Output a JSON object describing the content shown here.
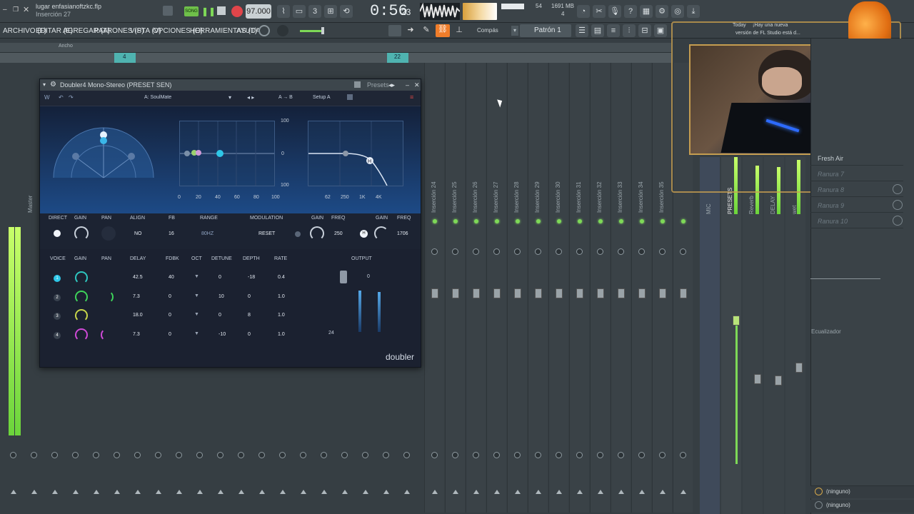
{
  "topbar": {
    "file_name": "lugar enfasianoftzkc.flp",
    "insert_label": "Inserción 27",
    "tempo": "97.000",
    "time": "0:56",
    "time_sub": "23",
    "cpu": "54",
    "memory": "1691 MB",
    "mem_sub": "4",
    "song_btn": "SONG",
    "notification_today": "Today",
    "notification_text": "¡Hay una nueva",
    "notification_text2": "versión de FL Studio está d..."
  },
  "menu": {
    "archivo": "ARCHIVO (F)",
    "editar": "EDITAR (E)",
    "agregar": "AGREGAR (A)",
    "patrones": "PATRONES (P)",
    "vista": "VISTA (V)",
    "opciones": "OPCIONES (O)",
    "herramientas": "HERRAMIENTAS (T)",
    "ayuda": "AYUDA",
    "snap_label": "Compás",
    "pattern": "Patrón 1"
  },
  "mixer": {
    "width_label": "Ancho",
    "master_label": "Master",
    "strip_labels": [
      "Inserción 24",
      "Inserción 25",
      "Inserción 26",
      "Inserción 27",
      "Inserción 28",
      "Inserción 29",
      "Inserción 30",
      "Inserción 31",
      "Inserción 32",
      "Inserción 33",
      "Inserción 34",
      "Inserción 35"
    ],
    "named_strips": [
      "MIC",
      "PRESETS",
      "Reverb",
      "DELAY",
      "wet"
    ],
    "ruler_ticks": [
      "4",
      "22"
    ]
  },
  "plugin": {
    "title": "Doubler4 Mono-Stereo (PRESET SEN)",
    "presets_label": "Presets",
    "preset_name": "A: SoulMate",
    "ab_label": "A → B",
    "setup_label": "Setup A",
    "brand": "doubler",
    "grid_top": "100",
    "grid_mid": "0",
    "grid_bottom": "100",
    "grid_x": [
      "0",
      "20",
      "40",
      "60",
      "80",
      "100"
    ],
    "eq_x": [
      "62",
      "250",
      "1K",
      "4K"
    ],
    "controls": {
      "direct": "DIRECT",
      "gain": "GAIN",
      "pan": "PAN",
      "align": "ALIGN",
      "fb": "FB",
      "range": "RANGE",
      "modulation": "MODULATION",
      "gain2": "GAIN",
      "freq": "FREQ",
      "gain3": "GAIN",
      "freq2": "FREQ",
      "align_val": "NO",
      "fb_val": "16",
      "range_val": "80HZ",
      "reset": "RESET",
      "freq_val": "250",
      "freq2_val": "1706"
    },
    "voice_headers": [
      "VOICE",
      "GAIN",
      "PAN",
      "DELAY",
      "FDBK",
      "OCT",
      "DETUNE",
      "DEPTH",
      "RATE"
    ],
    "output_label": "OUTPUT",
    "output_scale_top": "0",
    "output_scale_bottom": "24",
    "voices": [
      {
        "num": "1",
        "delay": "42.5",
        "fdbk": "40",
        "detune": "0",
        "depth": "-18",
        "rate": "0.4"
      },
      {
        "num": "2",
        "delay": "7.3",
        "fdbk": "0",
        "detune": "10",
        "depth": "0",
        "rate": "1.0"
      },
      {
        "num": "3",
        "delay": "18.0",
        "fdbk": "0",
        "detune": "0",
        "depth": "8",
        "rate": "1.0"
      },
      {
        "num": "4",
        "delay": "7.3",
        "fdbk": "0",
        "detune": "-10",
        "depth": "0",
        "rate": "1.0"
      }
    ]
  },
  "right_panel": {
    "slot_fresh": "Fresh Air",
    "slots": [
      "Ranura 7",
      "Ranura 8",
      "Ranura 9",
      "Ranura 10"
    ],
    "eq_label": "Ecualizador",
    "send1": "(ninguno)",
    "send2": "(ninguno)"
  },
  "colors": {
    "accent": "#7ed957",
    "plugin_bg": "#1d4a86",
    "webcam_border": "#c59d50"
  }
}
